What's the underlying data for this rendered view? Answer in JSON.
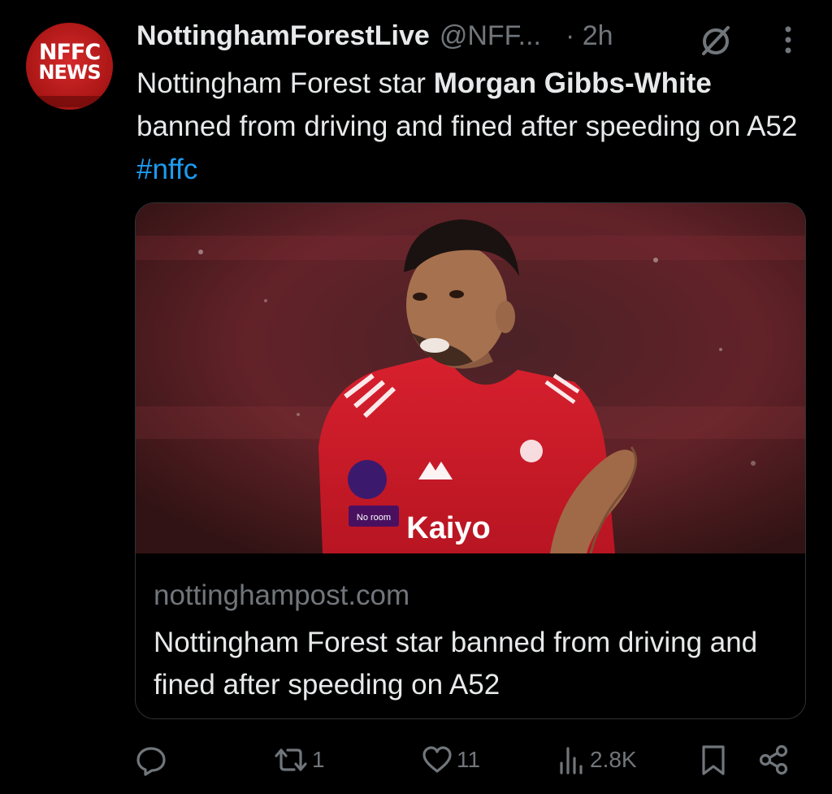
{
  "author": {
    "display_name": "NottinghamForestLive",
    "handle": "@NFF...",
    "time": "· 2h",
    "avatar_text_1": "NFFC",
    "avatar_text_2": "NEWS",
    "avatar_icon": "nffc-news-logo"
  },
  "tweet": {
    "text_prefix": "Nottingham Forest star ",
    "text_bold": "Morgan Gibbs-White",
    "text_suffix": " banned from driving and fined after speeding on A52 ",
    "hashtag": "#nffc"
  },
  "card": {
    "image_icon": "player-photo",
    "domain": "nottinghampost.com",
    "title": "Nottingham Forest star banned from driving and fined after speeding on A52"
  },
  "actions": {
    "reply": {
      "icon": "reply-icon",
      "count": ""
    },
    "retweet": {
      "icon": "retweet-icon",
      "count": "1"
    },
    "like": {
      "icon": "heart-icon",
      "count": "11"
    },
    "views": {
      "icon": "views-icon",
      "count": "2.8K"
    },
    "bookmark": {
      "icon": "bookmark-icon"
    },
    "share": {
      "icon": "share-icon"
    }
  },
  "colors": {
    "background": "#000000",
    "text": "#e7e9ea",
    "muted": "#71767b",
    "link": "#1d9bf0",
    "brand_red": "#c8202a"
  }
}
